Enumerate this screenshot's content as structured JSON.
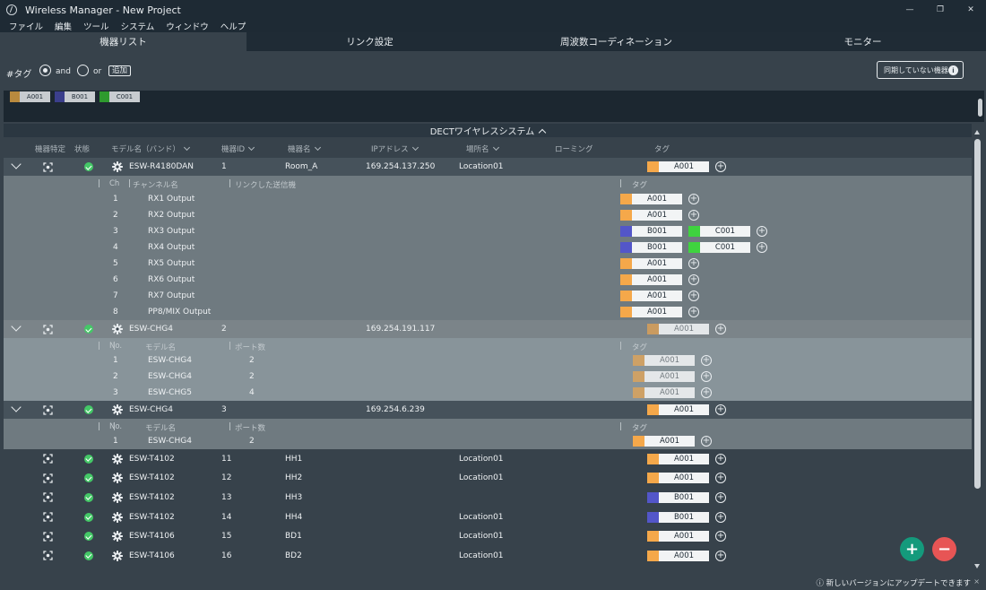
{
  "window": {
    "title": "Wireless Manager - New Project",
    "minimize": "—",
    "maximize": "❐",
    "close": "✕"
  },
  "menu": [
    "ファイル",
    "編集",
    "ツール",
    "システム",
    "ウィンドウ",
    "ヘルプ"
  ],
  "tabs": [
    "機器リスト",
    "リンク設定",
    "周波数コーディネーション",
    "モニター"
  ],
  "tagfilter": {
    "label": "#タグ",
    "and": "and",
    "or": "or",
    "add": "追加",
    "unsynced": "同期していない機器",
    "info": "i"
  },
  "tag_chips": [
    {
      "name": "A001",
      "color": "#b98a3e"
    },
    {
      "name": "B001",
      "color": "#3b3f8c"
    },
    {
      "name": "C001",
      "color": "#2e9a2e"
    }
  ],
  "section": {
    "title": "DECTワイヤレスシステム"
  },
  "columns": {
    "identify": "機器特定",
    "status": "状態",
    "model": "モデル名（バンド）",
    "device_id": "機器ID",
    "device_name": "機器名",
    "ip": "IPアドレス",
    "location": "場所名",
    "roaming": "ローミング",
    "tag": "タグ"
  },
  "colors": {
    "A001": "#f5a84a",
    "B001": "#5356c9",
    "C001": "#3fd33f"
  },
  "devices": [
    {
      "model": "ESW-R4180DAN",
      "id": "1",
      "name": "Room_A",
      "ip": "169.254.137.250",
      "location": "Location01",
      "tags": [
        "A001"
      ],
      "sub": {
        "headers": [
          "Ch",
          "チャンネル名",
          "リンクした送信機",
          "タグ"
        ],
        "rows": [
          {
            "a": "1",
            "b": "RX1 Output",
            "c": "",
            "tags": [
              "A001"
            ]
          },
          {
            "a": "2",
            "b": "RX2 Output",
            "c": "",
            "tags": [
              "A001"
            ]
          },
          {
            "a": "3",
            "b": "RX3 Output",
            "c": "",
            "tags": [
              "B001",
              "C001"
            ]
          },
          {
            "a": "4",
            "b": "RX4 Output",
            "c": "",
            "tags": [
              "B001",
              "C001"
            ]
          },
          {
            "a": "5",
            "b": "RX5 Output",
            "c": "",
            "tags": [
              "A001"
            ]
          },
          {
            "a": "6",
            "b": "RX6 Output",
            "c": "",
            "tags": [
              "A001"
            ]
          },
          {
            "a": "7",
            "b": "RX7 Output",
            "c": "",
            "tags": [
              "A001"
            ]
          },
          {
            "a": "8",
            "b": "PP8/MIX Output",
            "c": "",
            "tags": [
              "A001"
            ]
          }
        ]
      }
    },
    {
      "model": "ESW-CHG4",
      "id": "2",
      "name": "",
      "ip": "169.254.191.117",
      "location": "",
      "tags": [
        "A001"
      ],
      "sub": {
        "headers": [
          "No.",
          "モデル名",
          "ポート数",
          "タグ"
        ],
        "rows": [
          {
            "a": "1",
            "b": "ESW-CHG4",
            "c": "2",
            "tags": [
              "A001"
            ]
          },
          {
            "a": "2",
            "b": "ESW-CHG4",
            "c": "2",
            "tags": [
              "A001"
            ]
          },
          {
            "a": "3",
            "b": "ESW-CHG5",
            "c": "4",
            "tags": [
              "A001"
            ]
          }
        ]
      }
    },
    {
      "model": "ESW-CHG4",
      "id": "3",
      "name": "",
      "ip": "169.254.6.239",
      "location": "",
      "tags": [
        "A001"
      ],
      "sub": {
        "headers": [
          "No.",
          "モデル名",
          "ポート数",
          "タグ"
        ],
        "rows": [
          {
            "a": "1",
            "b": "ESW-CHG4",
            "c": "2",
            "tags": [
              "A001"
            ]
          }
        ]
      }
    },
    {
      "model": "ESW-T4102",
      "id": "11",
      "name": "HH1",
      "ip": "",
      "location": "Location01",
      "tags": [
        "A001"
      ]
    },
    {
      "model": "ESW-T4102",
      "id": "12",
      "name": "HH2",
      "ip": "",
      "location": "Location01",
      "tags": [
        "A001"
      ]
    },
    {
      "model": "ESW-T4102",
      "id": "13",
      "name": "HH3",
      "ip": "",
      "location": "",
      "tags": [
        "B001"
      ]
    },
    {
      "model": "ESW-T4102",
      "id": "14",
      "name": "HH4",
      "ip": "",
      "location": "Location01",
      "tags": [
        "B001"
      ]
    },
    {
      "model": "ESW-T4106",
      "id": "15",
      "name": "BD1",
      "ip": "",
      "location": "Location01",
      "tags": [
        "A001"
      ]
    },
    {
      "model": "ESW-T4106",
      "id": "16",
      "name": "BD2",
      "ip": "",
      "location": "Location01",
      "tags": [
        "A001"
      ]
    }
  ],
  "fab": {
    "add": "+",
    "remove": "−"
  },
  "statusbar": {
    "message": "新しいバージョンにアップデートできます",
    "info": "ⓘ",
    "close": "×"
  }
}
